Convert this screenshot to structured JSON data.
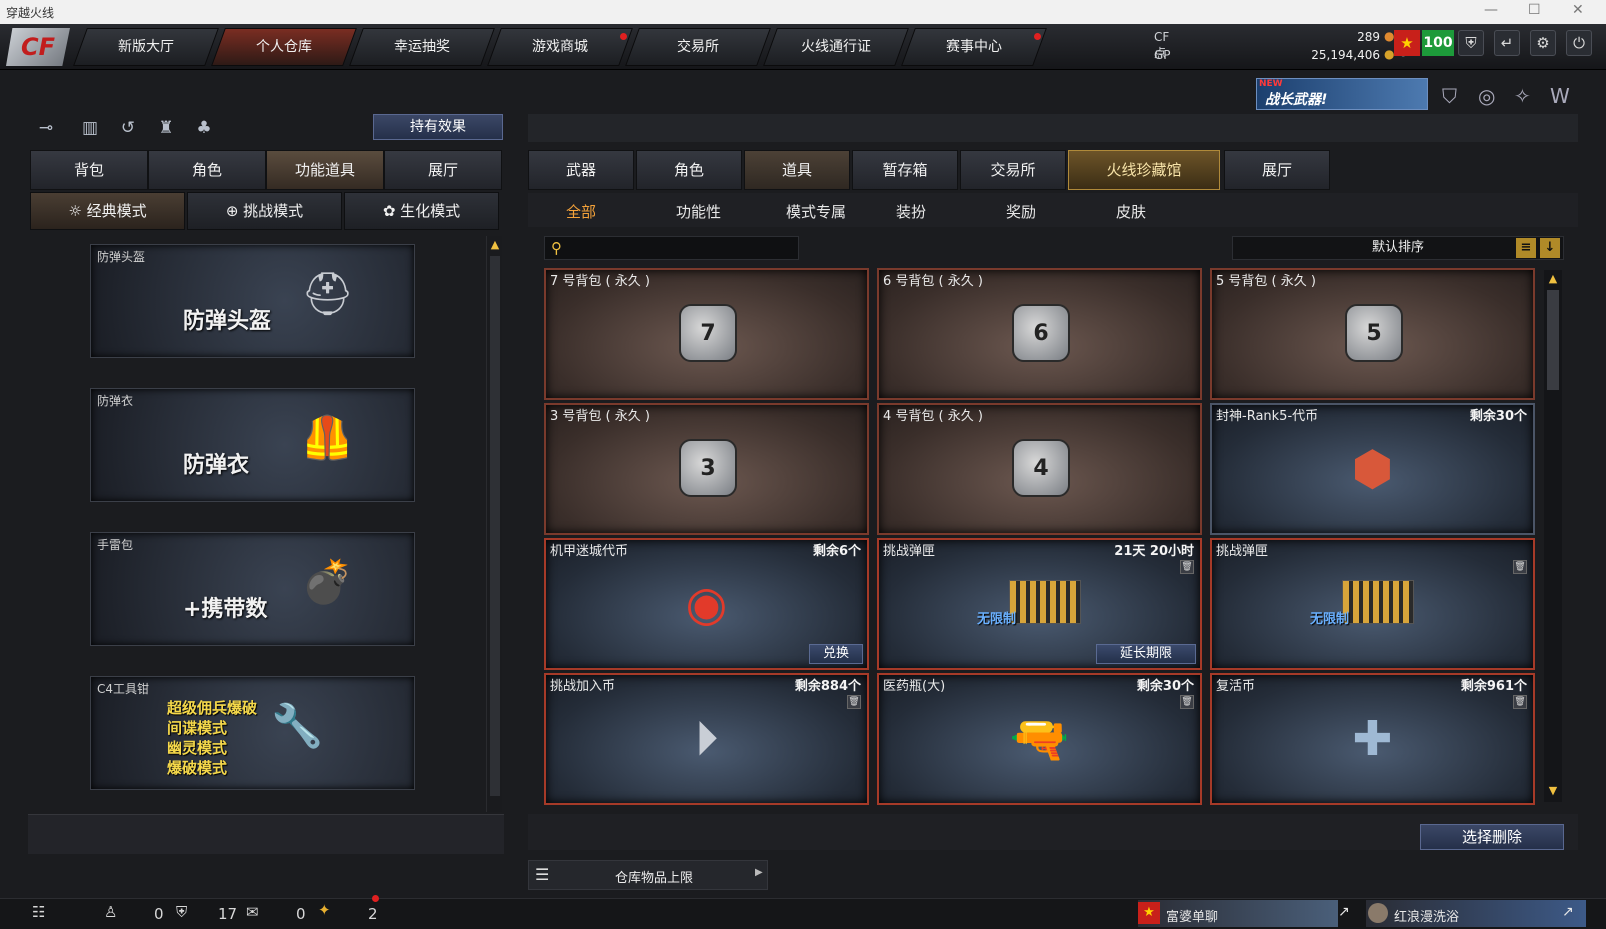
{
  "window": {
    "title": "穿越火线"
  },
  "nav": {
    "logo": "CF",
    "tabs": [
      "新版大厅",
      "个人仓库",
      "幸运抽奖",
      "游戏商城",
      "交易所",
      "火线通行证",
      "赛事中心"
    ],
    "active_index": 1,
    "dot_tabs": [
      3,
      6
    ]
  },
  "currency": {
    "cf_label": "CF点",
    "cf_value": "289",
    "gp_label": "GP",
    "gp_value": "25,194,406",
    "badge_value": "100"
  },
  "promo": {
    "new_label": "NEW",
    "text": "战长武器!"
  },
  "left": {
    "hold_button": "持有效果",
    "tabs": [
      "背包",
      "角色",
      "功能道具",
      "展厅"
    ],
    "active_tab": 2,
    "modes": [
      "经典模式",
      "挑战模式",
      "生化模式"
    ],
    "active_mode": 0,
    "cards": [
      {
        "label": "防弹头盔",
        "big": "防弹头盔",
        "icon": "helmet-icon"
      },
      {
        "label": "防弹衣",
        "big": "防弹衣",
        "icon": "vest-icon"
      },
      {
        "label": "手雷包",
        "big": "+携带数",
        "icon": "grenade-icon"
      },
      {
        "label": "C4工具钳",
        "lines": [
          "超级佣兵爆破",
          "间谍模式",
          "幽灵模式",
          "爆破模式"
        ],
        "icon": "c4-tool-icon"
      }
    ]
  },
  "right": {
    "tabs": [
      "武器",
      "角色",
      "道具",
      "暂存箱",
      "交易所",
      "火线珍藏馆",
      "展厅"
    ],
    "active_tab": 2,
    "highlight_tab": 5,
    "subtabs": [
      "全部",
      "功能性",
      "模式专属",
      "装扮",
      "奖励",
      "皮肤"
    ],
    "active_subtab": 0,
    "search_placeholder": "",
    "sort_label": "默认排序",
    "items": [
      {
        "name": "7 号背包 ( 永久 )",
        "count": "",
        "type": "bag",
        "num": "7"
      },
      {
        "name": "6 号背包 ( 永久 )",
        "count": "",
        "type": "bag",
        "num": "6"
      },
      {
        "name": "5 号背包 ( 永久 )",
        "count": "",
        "type": "bag",
        "num": "5"
      },
      {
        "name": "3 号背包 ( 永久 )",
        "count": "",
        "type": "bag",
        "num": "3"
      },
      {
        "name": "4 号背包 ( 永久 )",
        "count": "",
        "type": "bag",
        "num": "4"
      },
      {
        "name": "封神-Rank5-代币",
        "count": "剩余30个",
        "type": "token"
      },
      {
        "name": "机甲迷城代币",
        "count": "剩余6个",
        "type": "coin",
        "button": "兑换"
      },
      {
        "name": "挑战弹匣",
        "count": "21天 20小时",
        "type": "ammo",
        "button": "延长期限",
        "ammo_text": "无限制"
      },
      {
        "name": "挑战弹匣",
        "count": "",
        "type": "ammo",
        "ammo_text": "无限制"
      },
      {
        "name": "挑战加入币",
        "count": "剩余884个",
        "type": "join"
      },
      {
        "name": "医药瓶(大)",
        "count": "剩余30个",
        "type": "med"
      },
      {
        "name": "复活币",
        "count": "剩余961个",
        "type": "revive"
      }
    ],
    "delete_button": "选择删除",
    "storage_label": "仓库物品上限"
  },
  "status": {
    "count_a": "0",
    "count_b": "17",
    "count_c": "0",
    "count_d": "2",
    "chat1": "富婆单聊",
    "chat2": "红浪漫洗浴"
  }
}
